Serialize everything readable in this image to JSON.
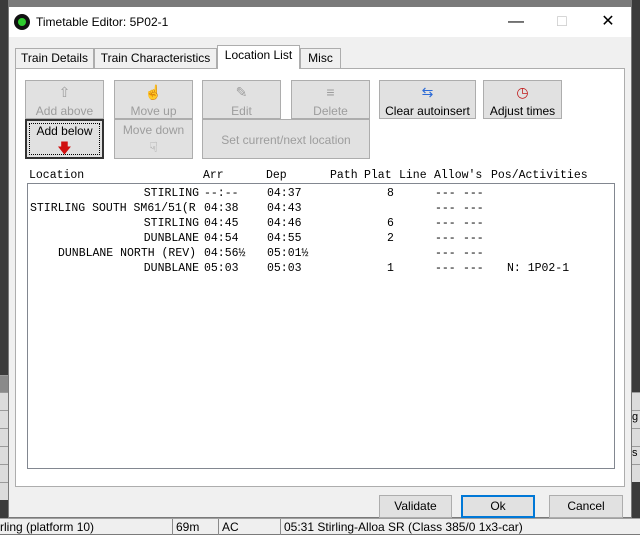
{
  "window": {
    "title": "Timetable Editor: 5P02-1"
  },
  "tabs": [
    {
      "label": "Train Details",
      "active": false
    },
    {
      "label": "Train Characteristics",
      "active": false
    },
    {
      "label": "Location List",
      "active": true
    },
    {
      "label": "Misc",
      "active": false
    }
  ],
  "toolbar": {
    "add_above": "Add above",
    "move_up": "Move up",
    "edit": "Edit",
    "delete": "Delete",
    "clear_autoinsert": "Clear autoinsert",
    "adjust_times": "Adjust times",
    "add_below": "Add below",
    "move_down": "Move down",
    "set_current_next": "Set current/next location"
  },
  "columns": [
    "Location",
    "Arr",
    "Dep",
    "Path",
    "Plat",
    "Line",
    "Allow's",
    "Pos/Activities"
  ],
  "rows": [
    {
      "location": "STIRLING",
      "arr": "--:--",
      "dep": "04:37",
      "plat": "8",
      "allow1": "---",
      "allow2": "---",
      "pos": ""
    },
    {
      "location": "STIRLING SOUTH SM61/51(R",
      "arr": "04:38",
      "dep": "04:43",
      "plat": "",
      "allow1": "---",
      "allow2": "---",
      "pos": ""
    },
    {
      "location": "STIRLING",
      "arr": "04:45",
      "dep": "04:46",
      "plat": "6",
      "allow1": "---",
      "allow2": "---",
      "pos": ""
    },
    {
      "location": "DUNBLANE",
      "arr": "04:54",
      "dep": "04:55",
      "plat": "2",
      "allow1": "---",
      "allow2": "---",
      "pos": ""
    },
    {
      "location": "DUNBLANE NORTH (REV)",
      "arr": "04:56½",
      "dep": "05:01½",
      "plat": "",
      "allow1": "---",
      "allow2": "---",
      "pos": ""
    },
    {
      "location": "DUNBLANE",
      "arr": "05:03",
      "dep": "05:03",
      "plat": "1",
      "allow1": "---",
      "allow2": "---",
      "pos": "N: 1P02-1"
    }
  ],
  "buttons": {
    "validate": "Validate",
    "ok": "Ok",
    "cancel": "Cancel"
  },
  "background": {
    "status_cells": [
      "rling (platform 10)",
      "69m",
      "AC",
      "05:31 Stirling-Alloa SR (Class 385/0 1x3-car)"
    ],
    "right_strip": [
      "g",
      "s"
    ]
  }
}
